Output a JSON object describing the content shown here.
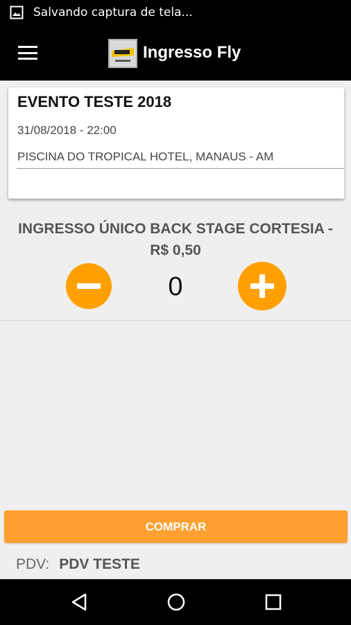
{
  "status_bar": {
    "notification_icon": "image-icon",
    "text": "Salvando captura de tela..."
  },
  "app_bar": {
    "menu_icon": "hamburger-menu-icon",
    "logo_icon": "ingresso-fly-logo",
    "title": "Ingresso Fly"
  },
  "event": {
    "title": "EVENTO TESTE 2018",
    "date": "31/08/2018 - 22:00",
    "location": "PISCINA DO TROPICAL HOTEL, MANAUS - AM"
  },
  "ticket": {
    "name_line1": "INGRESSO ÚNICO BACK STAGE CORTESIA -",
    "name_line2": "R$ 0,50",
    "quantity": "0",
    "minus_icon": "minus-icon",
    "plus_icon": "plus-icon"
  },
  "actions": {
    "buy_label": "COMPRAR"
  },
  "pdv": {
    "label": "PDV:",
    "value": "PDV TESTE"
  },
  "nav_bar": {
    "back_icon": "back-triangle-icon",
    "home_icon": "home-circle-icon",
    "recent_icon": "recent-apps-square-icon"
  },
  "colors": {
    "accent": "#ffa000",
    "button": "#ffa030",
    "bars": "#000000",
    "background": "#efefef"
  }
}
